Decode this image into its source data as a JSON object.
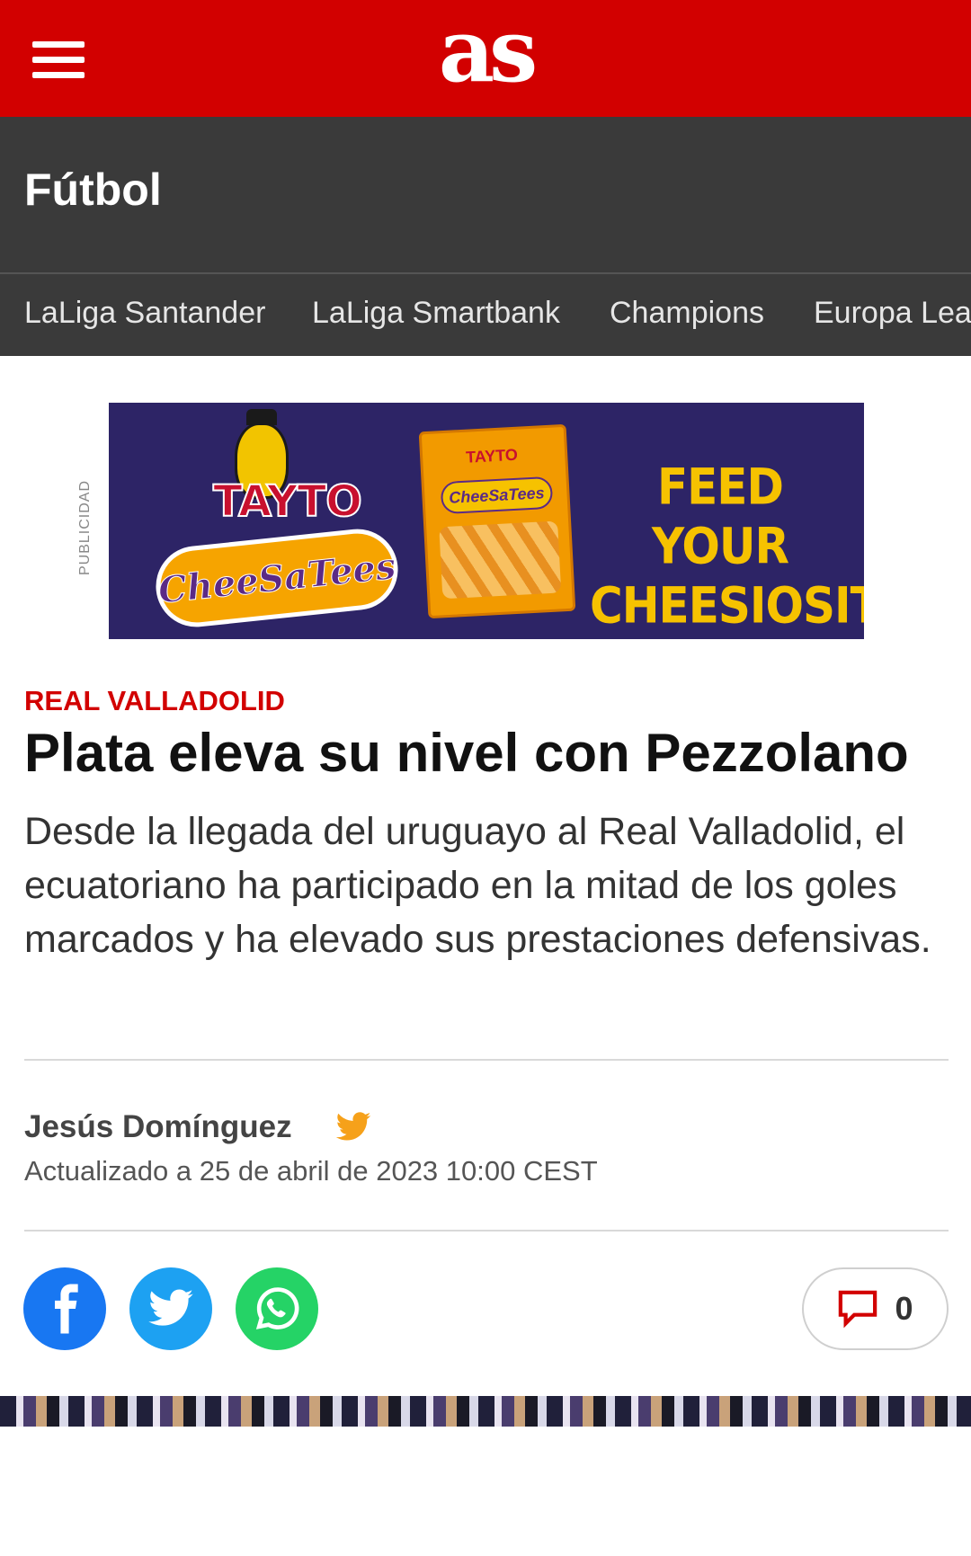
{
  "header": {
    "menu_icon": "hamburger-menu-icon",
    "logo_text": "as",
    "brand_color": "#d20000"
  },
  "section": {
    "title": "Fútbol"
  },
  "subnav": {
    "items": [
      "LaLiga Santander",
      "LaLiga Smartbank",
      "Champions",
      "Europa League"
    ]
  },
  "ad": {
    "label": "PUBLICIDAD",
    "brand": "TAYTO",
    "product": "CheeSaTees",
    "slogan_line1": "FEED YOUR",
    "slogan_line2": "CHEESIOSITY"
  },
  "article": {
    "kicker": "REAL VALLADOLID",
    "headline": "Plata eleva su nivel con Pezzolano",
    "standfirst": "Desde la llegada del uruguayo al Real Valladolid, el ecuatoriano ha participado en la mitad de los goles marcados y ha elevado sus prestaciones defensivas.",
    "author": "Jesús Domínguez",
    "author_icon": "twitter-icon",
    "updated": "Actualizado a 25 de abril de 2023 10:00 CEST"
  },
  "share": {
    "facebook_icon": "facebook-icon",
    "twitter_icon": "twitter-icon",
    "whatsapp_icon": "whatsapp-icon",
    "comments_icon": "comment-icon",
    "comments_count": "0"
  }
}
